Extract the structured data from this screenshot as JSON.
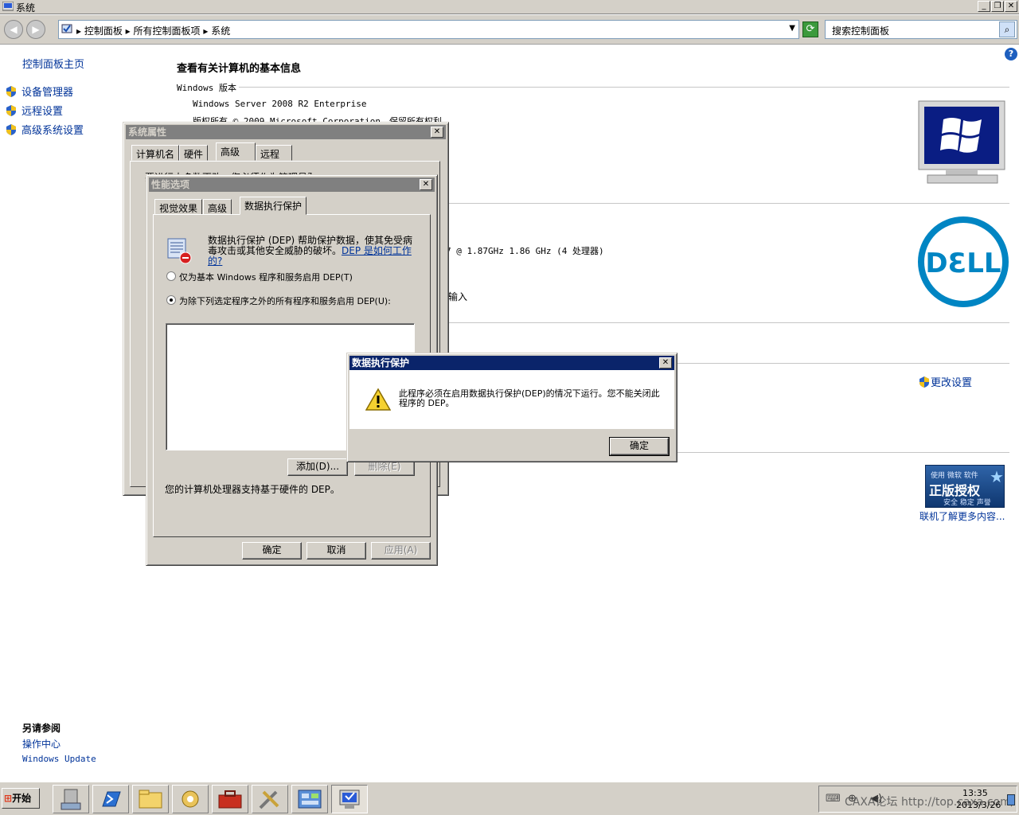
{
  "window": {
    "title": "系统"
  },
  "address": {
    "crumbs": [
      "控制面板",
      "所有控制面板项",
      "系统"
    ],
    "search_placeholder": "搜索控制面板"
  },
  "sidebar": {
    "home": "控制面板主页",
    "items": [
      {
        "label": "设备管理器"
      },
      {
        "label": "远程设置"
      },
      {
        "label": "高级系统设置"
      }
    ],
    "see_also_title": "另请参阅",
    "see_also": [
      "操作中心",
      "Windows Update"
    ]
  },
  "main": {
    "heading": "查看有关计算机的基本信息",
    "windows_edition_label": "Windows 版本",
    "edition": "Windows Server 2008 R2 Enterprise",
    "copyright": "版权所有 © 2009 Microsoft Corporation。保留所有权利。",
    "processor_fragment": "7  @ 1.87GHz   1.86 GHz  (4 处理器)",
    "pen_fragment": "输入",
    "change_settings": "更改设置",
    "genuine": {
      "small": "使用 微软 软件",
      "big": "正版授权",
      "sub": "安全 稳定 声誉"
    },
    "learn_more": "联机了解更多内容..."
  },
  "sysprops": {
    "title": "系统属性",
    "tabs": [
      "计算机名",
      "硬件",
      "高级",
      "远程"
    ],
    "partial_text": "要进行大多数更改，您必须作为管理员登录。"
  },
  "perf": {
    "title": "性能选项",
    "tabs": [
      "视觉效果",
      "高级",
      "数据执行保护"
    ],
    "description": "数据执行保护 (DEP) 帮助保护数据，使其免受病毒攻击或其他安全威胁的破坏。",
    "link": "DEP 是如何工作的?",
    "option1": "仅为基本 Windows 程序和服务启用 DEP(T)",
    "option2": "为除下列选定程序之外的所有程序和服务启用 DEP(U):",
    "add_button": "添加(D)...",
    "remove_button": "删除(E)",
    "hw_support": "您的计算机处理器支持基于硬件的 DEP。",
    "ok": "确定",
    "cancel": "取消",
    "apply": "应用(A)"
  },
  "alert": {
    "title": "数据执行保护",
    "message": "此程序必须在启用数据执行保护(DEP)的情况下运行。您不能关闭此程序的 DEP。",
    "ok": "确定"
  },
  "taskbar": {
    "start": "开始",
    "clock_time": "13:35",
    "clock_date": "2013/3/26",
    "watermark": "CAXA论坛 http://top.caxa.com/"
  },
  "colors": {
    "title_active": "#0a246a",
    "title_inactive": "#808080",
    "link": "#003399",
    "dell_blue": "#0085c3"
  }
}
